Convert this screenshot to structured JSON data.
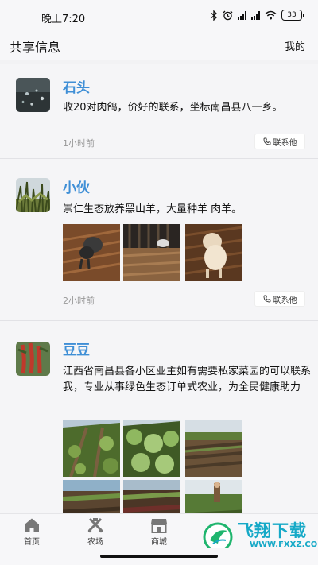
{
  "status": {
    "time": "晚上7:20",
    "battery": "33"
  },
  "header": {
    "title": "共享信息",
    "right": "我的"
  },
  "posts": [
    {
      "name": "石头",
      "content": "收20对肉鸽，价好的联系，坐标南昌县八一乡。",
      "time": "1小时前",
      "contact": "联系他"
    },
    {
      "name": "小伙",
      "content": "崇仁生态放养黑山羊，大量种羊  肉羊。",
      "time": "2小时前",
      "contact": "联系他"
    },
    {
      "name": "豆豆",
      "content": "江西省南昌县各小区业主如有需要私家菜园的可以联系我，专业从事绿色生态订单式农业，为全民健康助力"
    }
  ],
  "tabs": [
    {
      "label": "首页",
      "icon": "home-icon"
    },
    {
      "label": "农场",
      "icon": "farm-icon"
    },
    {
      "label": "商城",
      "icon": "store-icon"
    }
  ],
  "watermark": {
    "text": "飞翔下载",
    "url": "WWW.FXXZ.COM"
  },
  "icons": {
    "contact": "phone-icon"
  }
}
